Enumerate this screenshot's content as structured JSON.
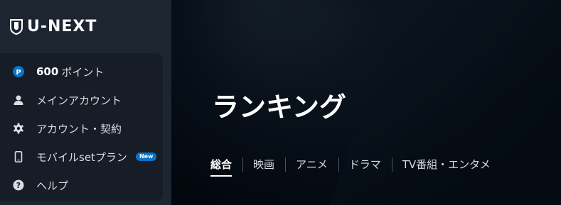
{
  "brand": {
    "name": "U-NEXT"
  },
  "sidebar": {
    "items": [
      {
        "icon": "points-icon",
        "value": "600",
        "label": " ポイント"
      },
      {
        "icon": "user-icon",
        "label": "メインアカウント"
      },
      {
        "icon": "gear-icon",
        "label": "アカウント・契約"
      },
      {
        "icon": "phone-icon",
        "label": "モバイルsetプラン",
        "badge": "New"
      },
      {
        "icon": "help-icon",
        "label": "ヘルプ"
      }
    ]
  },
  "main": {
    "title": "ランキング",
    "tabs": [
      {
        "label": "総合",
        "active": true
      },
      {
        "label": "映画"
      },
      {
        "label": "アニメ"
      },
      {
        "label": "ドラマ"
      },
      {
        "label": "TV番組・エンタメ"
      }
    ]
  },
  "colors": {
    "sidebar_bg": "#1d2530",
    "menu_card_bg": "#161d26",
    "badge_blue": "#0a74c9",
    "main_bg": "#000306"
  }
}
